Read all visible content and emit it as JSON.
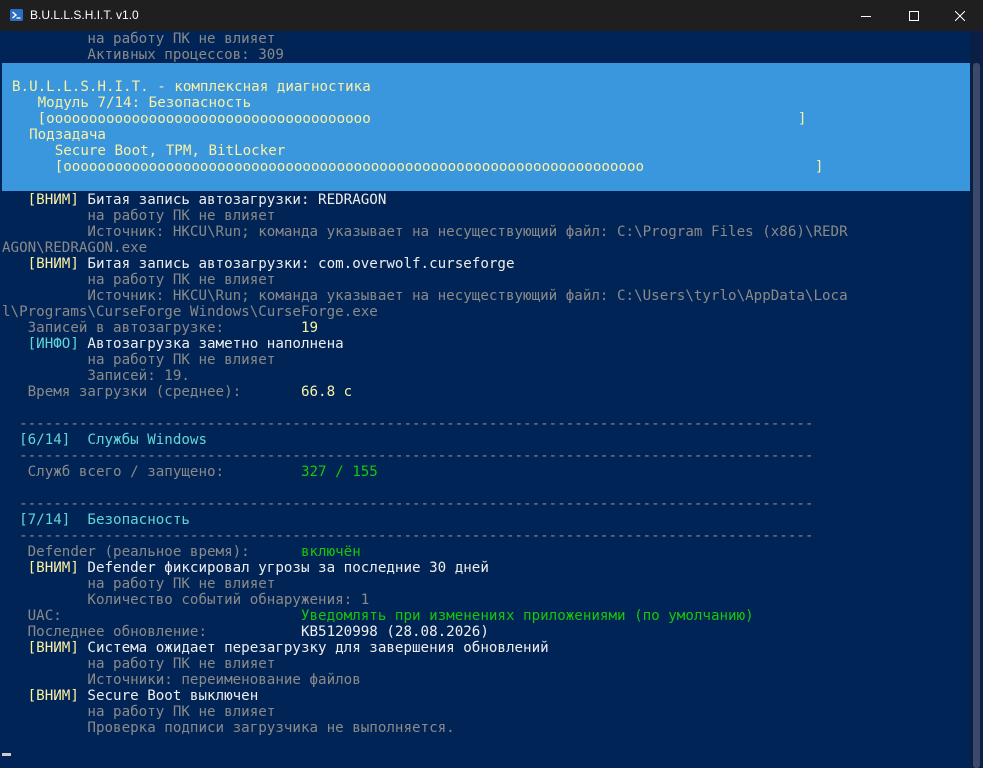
{
  "window": {
    "title": "B.U.L.L.S.H.I.T. v1.0",
    "icon": "powershell-icon",
    "controls": [
      "minimize-icon",
      "maximize-icon",
      "close-icon"
    ]
  },
  "colors": {
    "background": "#012456",
    "banner": "#3a96dd",
    "text": "#eeeeee",
    "dim": "#8a8a8a",
    "yellow": "#f9f1a5",
    "cyan": "#61d6d6",
    "green": "#16c60c"
  },
  "top_lines": {
    "l1": "          на работу ПК не влияет",
    "l2": "          Активных процессов: 309"
  },
  "banner": {
    "title": "B.U.L.L.S.H.I.T. - комплексная диагностика",
    "module": "   Модуль 7/14: Безопасность",
    "module_bar": "   [oooooooooooooooooooooooooooooooooooooo                                                  ]",
    "subtask_label": "  Подзадача",
    "subtask": "     Secure Boot, TPM, BitLocker",
    "subtask_bar": "     [oooooooooooooooooooooooooooooooooooooooooooooooooooooooooooooooooooo                    ]",
    "module_progress": 0.5,
    "subtask_progress": 0.75
  },
  "log": {
    "w1_tag": "   [ВНИМ]",
    "w1_text": " Битая запись автозагрузки: REDRAGON",
    "w1_impact": "          на работу ПК не влияет",
    "w1_source": "          Источник: HKCU\\Run; команда указывает на несуществующий файл: C:\\Program Files (x86)\\REDR",
    "w1_wrap": "AGON\\REDRAGON.exe",
    "w2_tag": "   [ВНИМ]",
    "w2_text": " Битая запись автозагрузки: com.overwolf.curseforge",
    "w2_impact": "          на работу ПК не влияет",
    "w2_source": "          Источник: HKCU\\Run; команда указывает на несуществующий файл: C:\\Users\\tyrlo\\AppData\\Loca",
    "w2_wrap": "l\\Programs\\CurseForge Windows\\CurseForge.exe",
    "autorun_label": "   Записей в автозагрузке:         ",
    "autorun_value": "19",
    "i1_tag": "   [ИНФО]",
    "i1_text": " Автозагрузка заметно наполнена",
    "i1_impact": "          на работу ПК не влияет",
    "i1_detail": "          Записей: 19.",
    "boot_label": "   Время загрузки (среднее):       ",
    "boot_value": "66.8 с",
    "sep1": "  ---------------------------------------------------------------------------------------------",
    "s6_num": "  [6/14]",
    "s6_title": "  Службы Windows",
    "sep2": "  ---------------------------------------------------------------------------------------------",
    "svc_label": "   Служб всего / запущено:         ",
    "svc_value": "327 / 155",
    "sep3": "  ---------------------------------------------------------------------------------------------",
    "s7_num": "  [7/14]",
    "s7_title": "  Безопасность",
    "sep4": "  ---------------------------------------------------------------------------------------------",
    "def_label": "   Defender (реальное время):      ",
    "def_value": "включён",
    "w3_tag": "   [ВНИМ]",
    "w3_text": " Defender фиксировал угрозы за последние 30 дней",
    "w3_impact": "          на работу ПК не влияет",
    "w3_detail": "          Количество событий обнаружения: 1",
    "uac_label": "   UAC:                            ",
    "uac_value": "Уведомлять при изменениях приложениями (по умолчанию)",
    "upd_label": "   Последнее обновление:           ",
    "upd_value": "KB5120998 (28.08.2026)",
    "w4_tag": "   [ВНИМ]",
    "w4_text": " Система ожидает перезагрузку для завершения обновлений",
    "w4_impact": "          на работу ПК не влияет",
    "w4_detail": "          Источники: переименование файлов",
    "w5_tag": "   [ВНИМ]",
    "w5_text": " Secure Boot выключен",
    "w5_impact": "          на работу ПК не влияет",
    "w5_detail": "          Проверка подписи загрузчика не выполняется."
  }
}
